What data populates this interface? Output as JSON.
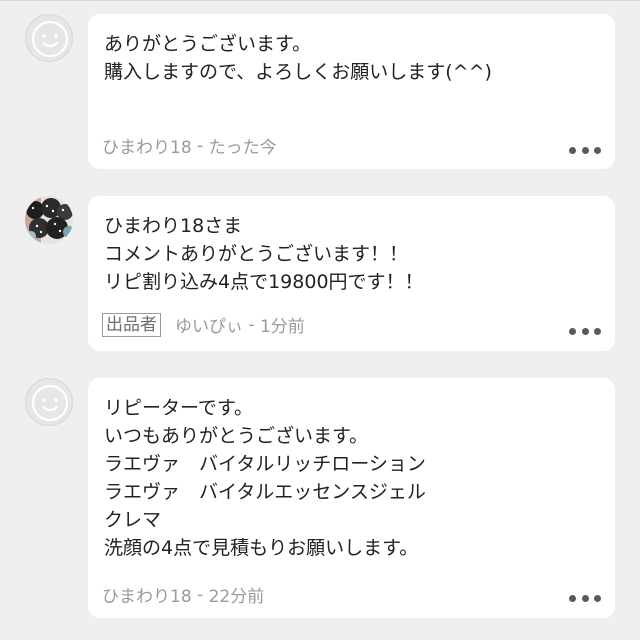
{
  "comments": [
    {
      "message": "ありがとうございます。\n購入しますので、よろしくお願いします(^^)",
      "author": "ひまわり18",
      "time": "たった今",
      "avatar": "default-avatar-icon"
    },
    {
      "message": "ひまわり18さま\nコメントありがとうございます！！\nリピ割り込み4点で19800円です！！",
      "badge": "出品者",
      "author": "ゆいぴぃ",
      "time": "1分前",
      "avatar": "user-photo-avatar"
    },
    {
      "message": "リピーターです。\nいつもありがとうございます。\nラエヴァ　バイタルリッチローション\nラエヴァ　バイタルエッセンスジェル\nクレマ\n洗顔の4点で見積もりお願いします。",
      "author": "ひまわり18",
      "time": "22分前",
      "avatar": "default-avatar-icon"
    }
  ],
  "separator": " - ",
  "colors": {
    "background": "#efefef",
    "bubble": "#ffffff",
    "meta_text": "#9a9a9a",
    "dots": "#5a5a5a"
  }
}
